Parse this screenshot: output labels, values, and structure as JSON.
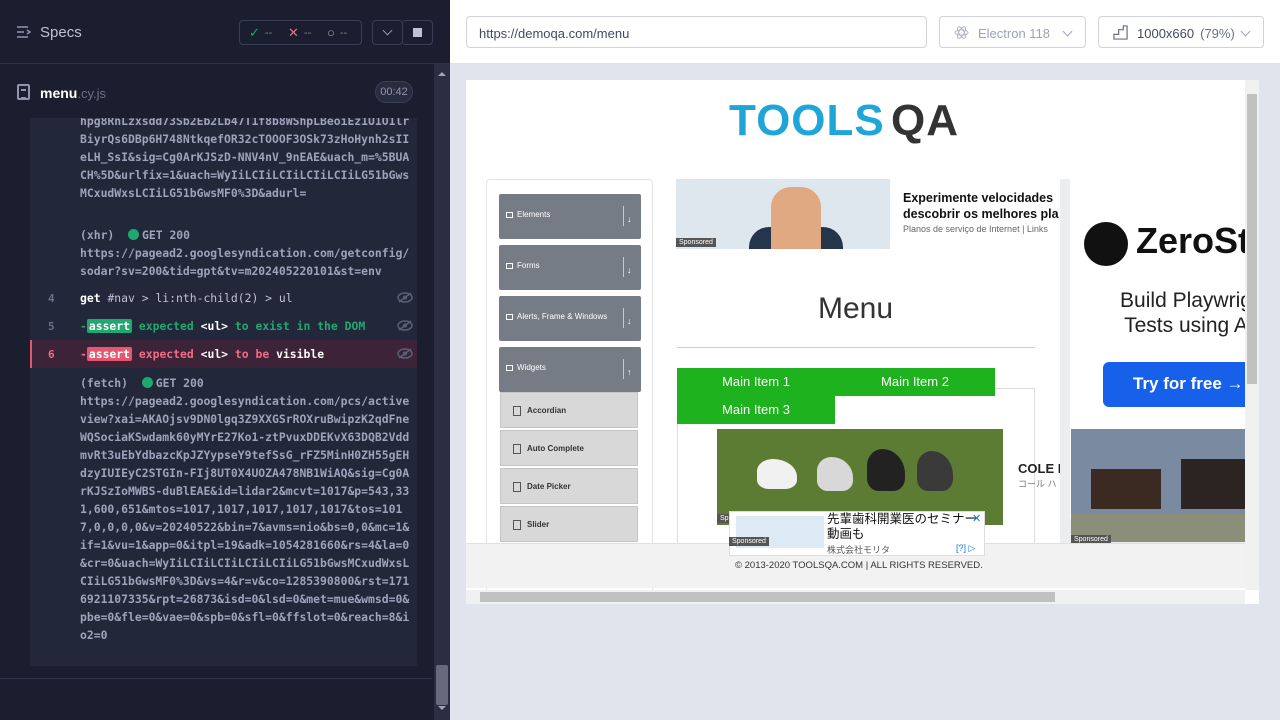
{
  "reporter": {
    "title": "Specs",
    "stats": {
      "passed": "--",
      "failed": "--",
      "pending": "--"
    },
    "file": {
      "name": "menu",
      "ext": ".cy.js",
      "time": "00:42"
    },
    "log_top": "hpg8RnLzxsdd73Sb2Eb2Lb47T1f8b8WShpLBeoiEz1U1O1lrBiyrQs6DBp6H748NtkqefOR32cTOOOF3OSk73zHoHynh2sIIeLH_SsI&sig=Cg0ArKJSzD-NNV4nV_9nEAE&uach_m=%5BUACH%5D&urlfix=1&uach=WyIiLCIiLCIiLCIiLCIiLG51bGwsMCxudWxsLCIiLG51bGwsMF0%3D&adurl=",
    "xhr": {
      "type": "(xhr)",
      "method": "GET 200",
      "url": "https://pagead2.googlesyndication.com/getconfig/sodar?sv=200&tid=gpt&tv=m202405220101&st=env"
    },
    "commands": [
      {
        "num": "4",
        "name": "get",
        "args": "#nav > li:nth-child(2) > ul"
      },
      {
        "num": "5",
        "prefix": "-",
        "badge": "assert",
        "text1": "expected",
        "code": "<ul>",
        "text2": "to exist in the DOM"
      },
      {
        "num": "6",
        "prefix": "-",
        "badge": "assert",
        "text1": "expected",
        "code": "<ul>",
        "text2": "to be",
        "text3": "visible"
      }
    ],
    "fetch": {
      "type": "(fetch)",
      "method": "GET 200",
      "url": "https://pagead2.googlesyndication.com/pcs/activeview?xai=AKAOjsv9DN0lgq3Z9XXGSrROXruBwipzK2qdFneWQSociaKSwdamk60yMYrE27Ko1-ztPvuxDDEKvX63DQB2VddmvRt3uEbYdbazcKpJZYypseY9tefSsG_rFZ5MinH0ZH55gEHdzyIUIEyC2STGIn-FIj8UT0X4UOZA478NB1WiAQ&sig=Cg0ArKJSzIoMWBS-duBlEAE&id=lidar2&mcvt=1017&p=543,331,600,651&mtos=1017,1017,1017,1017,1017&tos=1017,0,0,0,0&v=20240522&bin=7&avms=nio&bs=0,0&mc=1&if=1&vu=1&app=0&itpl=19&adk=1054281660&rs=4&la=0&cr=0&uach=WyIiLCIiLCIiLCIiLCIiLG51bGwsMCxudWxsLCIiLG51bGwsMF0%3D&vs=4&r=v&co=1285390800&rst=1716921107335&rpt=26873&isd=0&lsd=0&met=mue&wmsd=0&pbe=0&fle=0&vae=0&spb=0&sfl=0&ffslot=0&reach=8&io2=0"
    }
  },
  "toolbar": {
    "url": "https://demoqa.com/menu",
    "browser": "Electron 118",
    "viewport": "1000x660",
    "zoom": "(79%)"
  },
  "aut": {
    "logo_a": "TOOLS",
    "logo_b": "QA",
    "sidebar": {
      "categories": [
        "Elements",
        "Forms",
        "Alerts, Frame & Windows",
        "Widgets"
      ],
      "sub_items": [
        "Accordian",
        "Auto Complete",
        "Date Picker",
        "Slider"
      ]
    },
    "ad_top": {
      "line1": "Experimente velocidades",
      "line2": "descobrir os melhores pla",
      "sub": "Planos de serviço de Internet | Links",
      "sponsored": "Sponsored"
    },
    "heading": "Menu",
    "menu_items": [
      "Main Item 1",
      "Main Item 2",
      "Main Item 3"
    ],
    "ad_shoes": {
      "title": "COLE H",
      "sub": "コール ハ",
      "sponsored": "Sp"
    },
    "zerostep": {
      "name": "ZeroSt",
      "line1": "Build Playwrig",
      "line2": "Tests using A",
      "button": "Try for free →",
      "sponsored": "Sponsored"
    },
    "ad_jp": {
      "line1": "先輩歯科開業医のセミナー",
      "line2": "動画も",
      "company": "株式会社モリタ",
      "sponsored": "Sponsored"
    },
    "footer": "© 2013-2020 TOOLSQA.COM | ALL RIGHTS RESERVED."
  }
}
